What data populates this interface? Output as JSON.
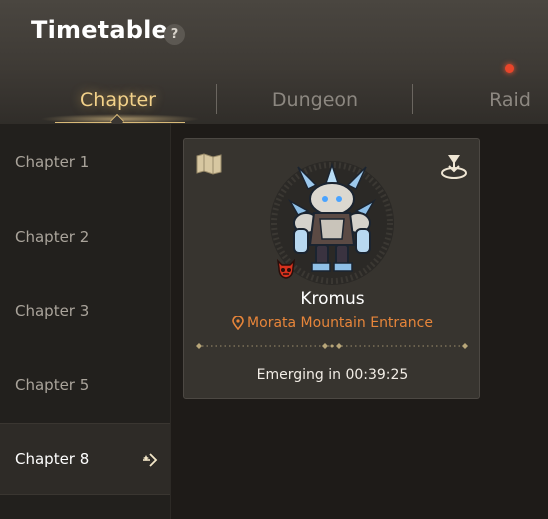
{
  "header": {
    "title": "Timetable",
    "help_glyph": "?",
    "notification_color": "#e8452a"
  },
  "tabs": [
    {
      "label": "Chapter",
      "active": true
    },
    {
      "label": "Dungeon",
      "active": false
    },
    {
      "label": "Raid",
      "active": false,
      "has_notification": true
    }
  ],
  "sidebar": {
    "items": [
      {
        "label": "Chapter 1",
        "selected": false
      },
      {
        "label": "Chapter 2",
        "selected": false
      },
      {
        "label": "Chapter 3",
        "selected": false
      },
      {
        "label": "Chapter 5",
        "selected": false
      },
      {
        "label": "Chapter 8",
        "selected": true,
        "icon": "sparkle-arrow-icon"
      }
    ]
  },
  "boss_card": {
    "name": "Kromus",
    "location": "Morata Mountain Entrance",
    "timer_text": "Emerging in 00:39:25",
    "icons": [
      "map-icon",
      "teleport-icon",
      "location-pin-icon",
      "demon-skull-icon"
    ],
    "accent_color": "#e7853a"
  },
  "colors": {
    "tab_active": "#f3d28a",
    "background": "#1e1b18",
    "card": "#37342f"
  }
}
